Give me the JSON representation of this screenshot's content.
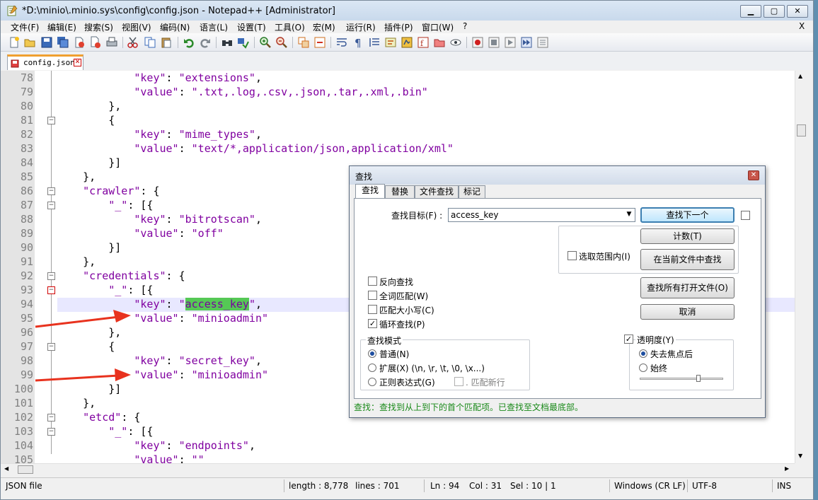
{
  "window": {
    "title": "*D:\\minio\\.minio.sys\\config\\config.json - Notepad++ [Administrator]"
  },
  "menu": [
    "文件(F)",
    "编辑(E)",
    "搜索(S)",
    "视图(V)",
    "编码(N)",
    "语言(L)",
    "设置(T)",
    "工具(O)",
    "宏(M)",
    "运行(R)",
    "插件(P)",
    "窗口(W)",
    "?"
  ],
  "menu_close": "X",
  "tab": {
    "label": "config.json"
  },
  "editor": {
    "lines": [
      {
        "n": "78",
        "t": "            \"key\": \"extensions\","
      },
      {
        "n": "79",
        "t": "            \"value\": \".txt,.log,.csv,.json,.tar,.xml,.bin\""
      },
      {
        "n": "80",
        "t": "        },"
      },
      {
        "n": "81",
        "t": "        {"
      },
      {
        "n": "82",
        "t": "            \"key\": \"mime_types\","
      },
      {
        "n": "83",
        "t": "            \"value\": \"text/*,application/json,application/xml\""
      },
      {
        "n": "84",
        "t": "        }]"
      },
      {
        "n": "85",
        "t": "    },"
      },
      {
        "n": "86",
        "t": "    \"crawler\": {"
      },
      {
        "n": "87",
        "t": "        \"_\": [{"
      },
      {
        "n": "88",
        "t": "            \"key\": \"bitrotscan\","
      },
      {
        "n": "89",
        "t": "            \"value\": \"off\""
      },
      {
        "n": "90",
        "t": "        }]"
      },
      {
        "n": "91",
        "t": "    },"
      },
      {
        "n": "92",
        "t": "    \"credentials\": {"
      },
      {
        "n": "93",
        "t": "        \"_\": [{"
      },
      {
        "n": "94",
        "t": "            \"key\": \"access_key\","
      },
      {
        "n": "95",
        "t": "            \"value\": \"minioadmin\""
      },
      {
        "n": "96",
        "t": "        },"
      },
      {
        "n": "97",
        "t": "        {"
      },
      {
        "n": "98",
        "t": "            \"key\": \"secret_key\","
      },
      {
        "n": "99",
        "t": "            \"value\": \"minioadmin\""
      },
      {
        "n": "100",
        "t": "        }]"
      },
      {
        "n": "101",
        "t": "    },"
      },
      {
        "n": "102",
        "t": "    \"etcd\": {"
      },
      {
        "n": "103",
        "t": "        \"_\": [{"
      },
      {
        "n": "104",
        "t": "            \"key\": \"endpoints\","
      },
      {
        "n": "105",
        "t": "            \"value\": \"\""
      }
    ],
    "highlight_line": "94",
    "selected_text": "access_key"
  },
  "status": {
    "file_type": "JSON file",
    "length": "length : 8,778",
    "lines": "lines : 701",
    "ln": "Ln : 94",
    "col": "Col : 31",
    "sel": "Sel : 10 | 1",
    "eol": "Windows (CR LF)",
    "encoding": "UTF-8",
    "mode": "INS"
  },
  "find_dialog": {
    "title": "查找",
    "tabs": [
      "查找",
      "替换",
      "文件查找",
      "标记"
    ],
    "find_label": "查找目标(F) :",
    "find_value": "access_key",
    "buttons": {
      "find_next": "查找下一个",
      "count": "计数(T)",
      "find_in_current": "在当前文件中查找",
      "find_in_all_open": "查找所有打开文件(O)",
      "cancel": "取消"
    },
    "in_selection": "选取范围内(I)",
    "options": [
      {
        "label": "反向查找",
        "checked": false
      },
      {
        "label": "全词匹配(W)",
        "checked": false
      },
      {
        "label": "匹配大小写(C)",
        "checked": false
      },
      {
        "label": "循环查找(P)",
        "checked": true
      }
    ],
    "search_mode": {
      "title": "查找模式",
      "normal": "普通(N)",
      "extended": "扩展(X) (\\n, \\r, \\t, \\0, \\x...)",
      "regex": "正则表达式(G)",
      "dot_newline": ". 匹配新行"
    },
    "transparency": {
      "title": "透明度(Y)",
      "on_lose_focus": "失去焦点后",
      "always": "始终"
    },
    "status_text": "查找：查找到从上到下的首个匹配项。已查找至文档最底部。"
  },
  "colors": {
    "key_string": "#8000a0",
    "selection": "#55c855",
    "annotation_arrow": "#e8321e"
  }
}
